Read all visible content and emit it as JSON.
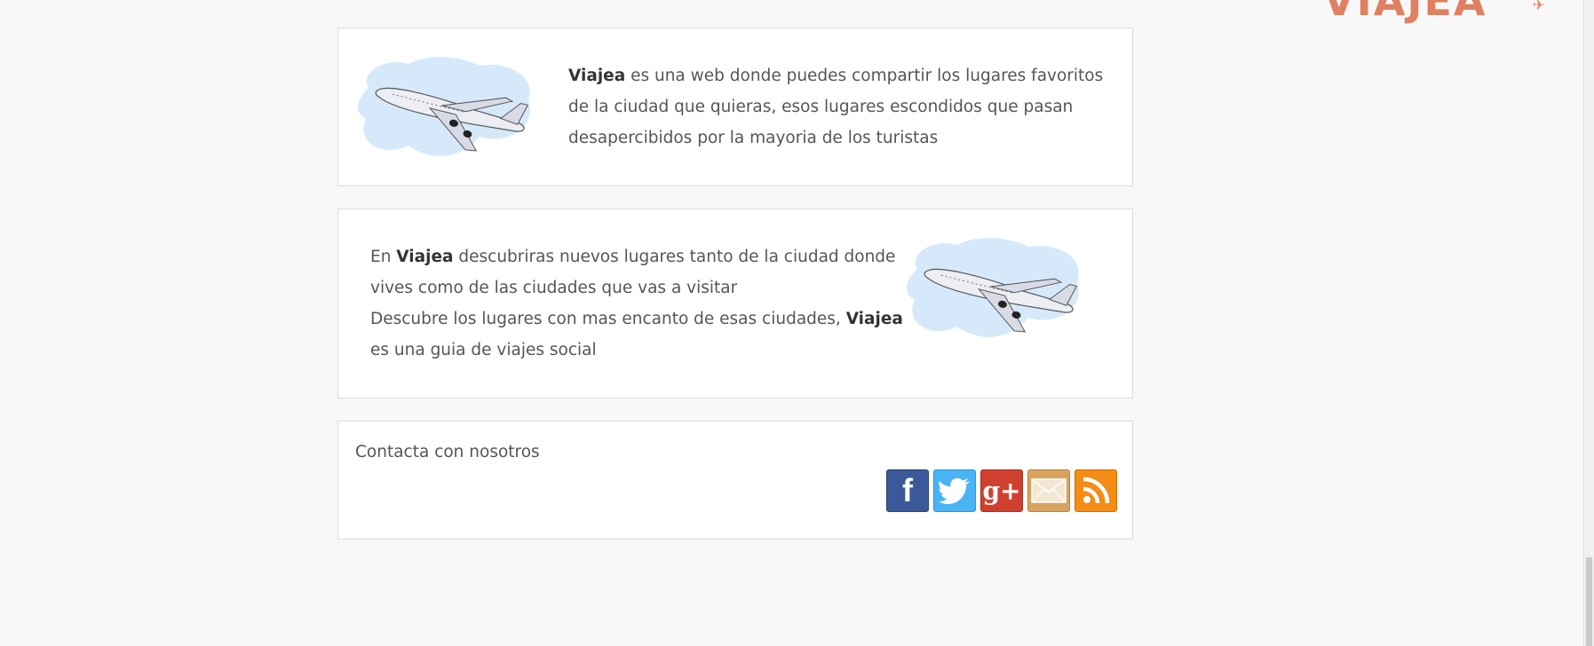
{
  "logo": {
    "text": "VIAJEA"
  },
  "about": {
    "brand": "Viajea",
    "text1_rest": " es una web donde puedes compartir los lugares favoritos de la ciudad que quieras, esos lugares escondidos que pasan desapercibidos por la mayoria de los turistas",
    "text2_prefix": "En ",
    "text2_middle": " descubriras nuevos lugares tanto de la ciudad donde vives como de las ciudades que vas a visitar",
    "text2_line2_prefix": "Descubre los lugares con mas encanto de esas ciudades, ",
    "text2_line2_suffix": " es una guia de viajes social"
  },
  "contact": {
    "title": "Contacta con nosotros",
    "social": [
      {
        "name": "facebook",
        "icon": "facebook-icon",
        "glyph": "f",
        "color": "#3b5998"
      },
      {
        "name": "twitter",
        "icon": "twitter-icon",
        "color": "#4ab3f4"
      },
      {
        "name": "google-plus",
        "icon": "google-plus-icon",
        "glyph": "g+",
        "color": "#d0402f"
      },
      {
        "name": "email",
        "icon": "mail-icon",
        "color": "#d9a25f"
      },
      {
        "name": "rss",
        "icon": "rss-icon",
        "color": "#f48c15"
      }
    ]
  },
  "colors": {
    "logo": "#e08060",
    "card_bg": "#ffffff",
    "page_bg": "#f8f8f8"
  }
}
